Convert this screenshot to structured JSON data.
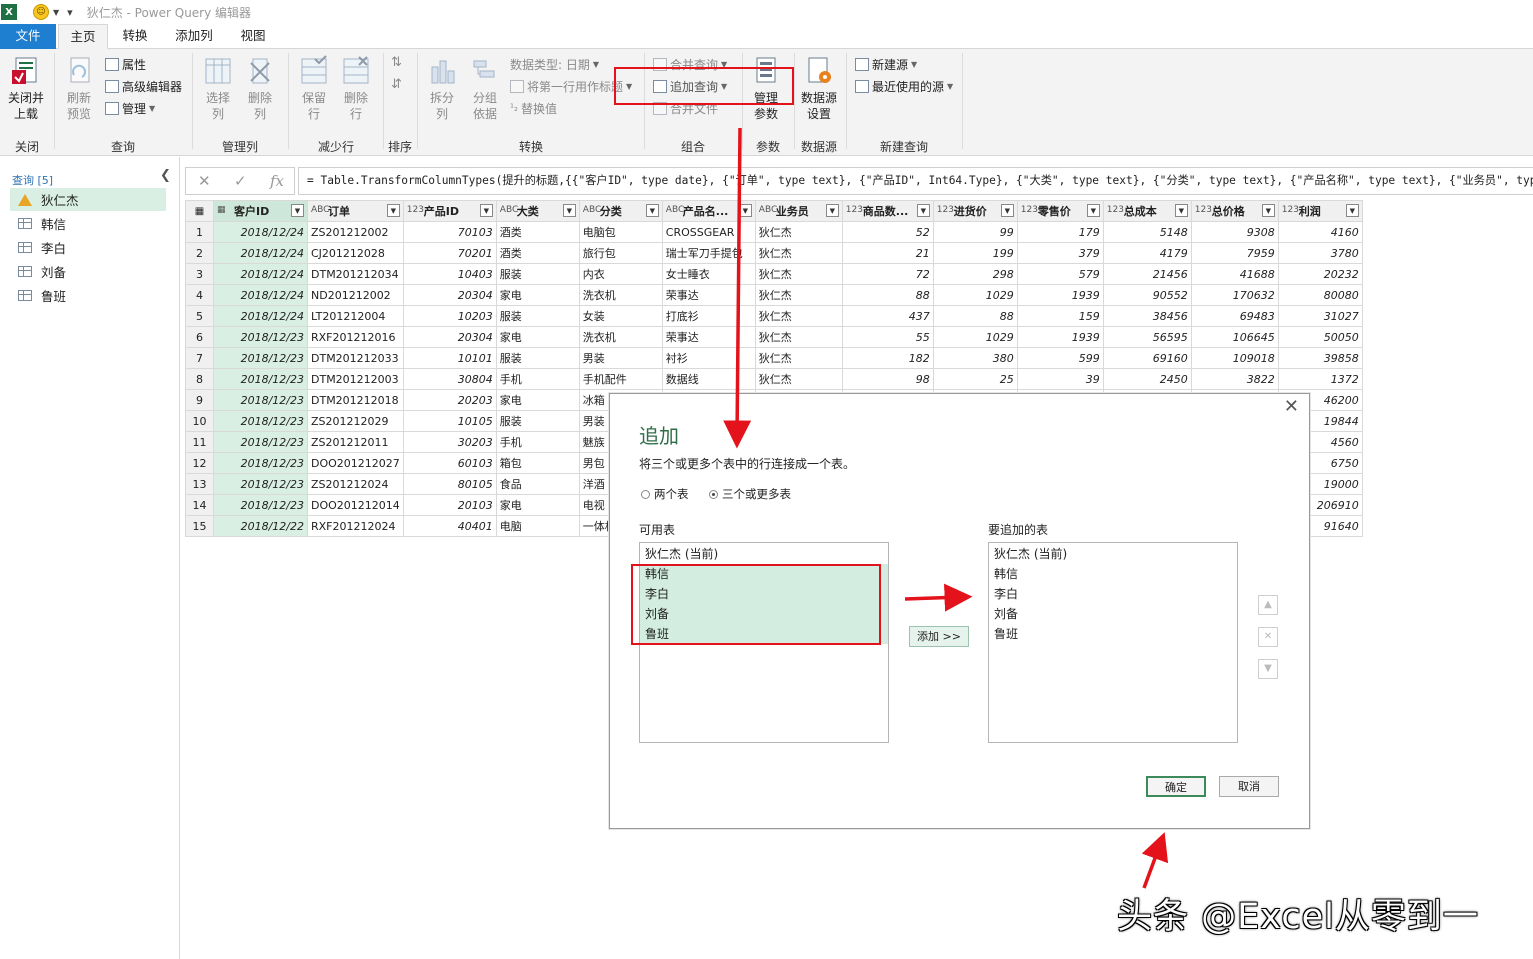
{
  "titlebar": {
    "app_icon": "X",
    "app_title": "狄仁杰 - Power Query 编辑器"
  },
  "tabs": [
    "文件",
    "主页",
    "转换",
    "添加列",
    "视图"
  ],
  "ribbon": {
    "close_load": "关闭并\n上载",
    "refresh_preview": "刷新\n预览",
    "properties": "属性",
    "advanced_editor": "高级编辑器",
    "manage": "管理",
    "choose_cols": "选择\n列",
    "remove_cols": "删除\n列",
    "keep_rows": "保留\n行",
    "remove_rows": "删除\n行",
    "split_col": "拆分\n列",
    "group_by": "分组\n依据",
    "data_type": "数据类型: 日期",
    "first_row_header": "将第一行用作标题",
    "replace_values": "替换值",
    "merge_queries": "合并查询",
    "append_queries": "追加查询",
    "combine_files": "合并文件",
    "manage_params": "管理\n参数",
    "data_source_settings": "数据源\n设置",
    "new_source": "新建源",
    "recent_sources": "最近使用的源",
    "groups": {
      "close": "关闭",
      "query": "查询",
      "manage_cols": "管理列",
      "reduce_rows": "减少行",
      "sort": "排序",
      "transform": "转换",
      "combine": "组合",
      "params": "参数",
      "data_source": "数据源",
      "new_query": "新建查询"
    }
  },
  "queries": {
    "header": "查询 [5]",
    "items": [
      "狄仁杰",
      "韩信",
      "李白",
      "刘备",
      "鲁班"
    ]
  },
  "formula_bar": {
    "fx": "fx",
    "formula": "= Table.TransformColumnTypes(提升的标题,{{\"客户ID\", type date}, {\"订单\", type text}, {\"产品ID\", Int64.Type}, {\"大类\", type text}, {\"分类\", type text}, {\"产品名称\", type text}, {\"业务员\", type text}"
  },
  "table": {
    "columns": [
      {
        "name": "客户ID",
        "type_icon": "▦"
      },
      {
        "name": "订单",
        "type_icon": "ABC"
      },
      {
        "name": "产品ID",
        "type_icon": "123"
      },
      {
        "name": "大类",
        "type_icon": "ABC"
      },
      {
        "name": "分类",
        "type_icon": "ABC"
      },
      {
        "name": "产品名...",
        "type_icon": "ABC"
      },
      {
        "name": "业务员",
        "type_icon": "ABC"
      },
      {
        "name": "商品数...",
        "type_icon": "123"
      },
      {
        "name": "进货价",
        "type_icon": "123"
      },
      {
        "name": "零售价",
        "type_icon": "123"
      },
      {
        "name": "总成本",
        "type_icon": "123"
      },
      {
        "name": "总价格",
        "type_icon": "123"
      },
      {
        "name": "利润",
        "type_icon": "123"
      }
    ],
    "rows": [
      [
        "1",
        "2018/12/24",
        "ZS201212002",
        "70103",
        "酒类",
        "电脑包",
        "CROSSGEAR",
        "狄仁杰",
        "52",
        "99",
        "179",
        "5148",
        "9308",
        "4160"
      ],
      [
        "2",
        "2018/12/24",
        "CJ201212028",
        "70201",
        "酒类",
        "旅行包",
        "瑞士军刀手提包",
        "狄仁杰",
        "21",
        "199",
        "379",
        "4179",
        "7959",
        "3780"
      ],
      [
        "3",
        "2018/12/24",
        "DTM201212034",
        "10403",
        "服装",
        "内衣",
        "女士睡衣",
        "狄仁杰",
        "72",
        "298",
        "579",
        "21456",
        "41688",
        "20232"
      ],
      [
        "4",
        "2018/12/24",
        "ND201212002",
        "20304",
        "家电",
        "洗衣机",
        "荣事达",
        "狄仁杰",
        "88",
        "1029",
        "1939",
        "90552",
        "170632",
        "80080"
      ],
      [
        "5",
        "2018/12/24",
        "LT201212004",
        "10203",
        "服装",
        "女装",
        "打底衫",
        "狄仁杰",
        "437",
        "88",
        "159",
        "38456",
        "69483",
        "31027"
      ],
      [
        "6",
        "2018/12/23",
        "RXF201212016",
        "20304",
        "家电",
        "洗衣机",
        "荣事达",
        "狄仁杰",
        "55",
        "1029",
        "1939",
        "56595",
        "106645",
        "50050"
      ],
      [
        "7",
        "2018/12/23",
        "DTM201212033",
        "10101",
        "服装",
        "男装",
        "衬衫",
        "狄仁杰",
        "182",
        "380",
        "599",
        "69160",
        "109018",
        "39858"
      ],
      [
        "8",
        "2018/12/23",
        "DTM201212003",
        "30804",
        "手机",
        "手机配件",
        "数据线",
        "狄仁杰",
        "98",
        "25",
        "39",
        "2450",
        "3822",
        "1372"
      ],
      [
        "9",
        "2018/12/23",
        "DTM201212018",
        "20203",
        "家电",
        "冰箱",
        "",
        "",
        "",
        "",
        "",
        "",
        "",
        "46200"
      ],
      [
        "10",
        "2018/12/23",
        "ZS201212029",
        "10105",
        "服装",
        "男装",
        "",
        "",
        "",
        "",
        "",
        "",
        "",
        "19844"
      ],
      [
        "11",
        "2018/12/23",
        "ZS201212011",
        "30203",
        "手机",
        "魅族",
        "",
        "",
        "",
        "",
        "",
        "",
        "",
        "4560"
      ],
      [
        "12",
        "2018/12/23",
        "DOO201212027",
        "60103",
        "箱包",
        "男包",
        "",
        "",
        "",
        "",
        "",
        "",
        "",
        "6750"
      ],
      [
        "13",
        "2018/12/23",
        "ZS201212024",
        "80105",
        "食品",
        "洋酒",
        "",
        "",
        "",
        "",
        "",
        "",
        "",
        "19000"
      ],
      [
        "14",
        "2018/12/23",
        "DOO201212014",
        "20103",
        "家电",
        "电视",
        "",
        "",
        "",
        "",
        "",
        "",
        "",
        "206910"
      ],
      [
        "15",
        "2018/12/22",
        "RXF201212024",
        "40401",
        "电脑",
        "一体机",
        "",
        "",
        "",
        "",
        "",
        "",
        "",
        "91640"
      ]
    ]
  },
  "dialog": {
    "title": "追加",
    "description": "将三个或更多个表中的行连接成一个表。",
    "radio_two": "两个表",
    "radio_three": "三个或更多表",
    "available_label": "可用表",
    "available": [
      "狄仁杰 (当前)",
      "韩信",
      "李白",
      "刘备",
      "鲁班"
    ],
    "append_label": "要追加的表",
    "appended": [
      "狄仁杰 (当前)",
      "韩信",
      "李白",
      "刘备",
      "鲁班"
    ],
    "add_button": "添加 >>",
    "ok": "确定",
    "cancel": "取消"
  },
  "watermark": "头条 @Excel从零到一",
  "colors": {
    "accent": "#1e7ecf",
    "highlight": "#e4121a",
    "selection": "#d9efe4"
  }
}
